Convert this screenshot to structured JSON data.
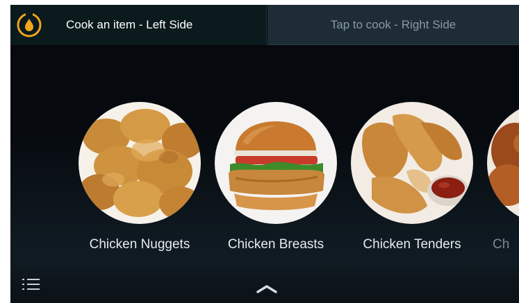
{
  "header": {
    "logo_icon": "oil-drop-icon",
    "left_tab_label": "Cook an item - Left Side",
    "right_tab_label": "Tap to cook - Right Side"
  },
  "menu": {
    "items": [
      {
        "label": "Chicken Nuggets",
        "image": "chicken-nuggets-image"
      },
      {
        "label": "Chicken Breasts",
        "image": "chicken-sandwich-image"
      },
      {
        "label": "Chicken Tenders",
        "image": "chicken-tenders-image"
      },
      {
        "label": "Ch",
        "image": "fried-chicken-image"
      }
    ]
  },
  "footer": {
    "list_icon": "list-icon",
    "expand_icon": "chevron-up-icon"
  },
  "colors": {
    "accent": "#f2a51e",
    "background": "#05080b",
    "active_tab": "#0a1a1d",
    "inactive_tab": "#1d2c35"
  }
}
